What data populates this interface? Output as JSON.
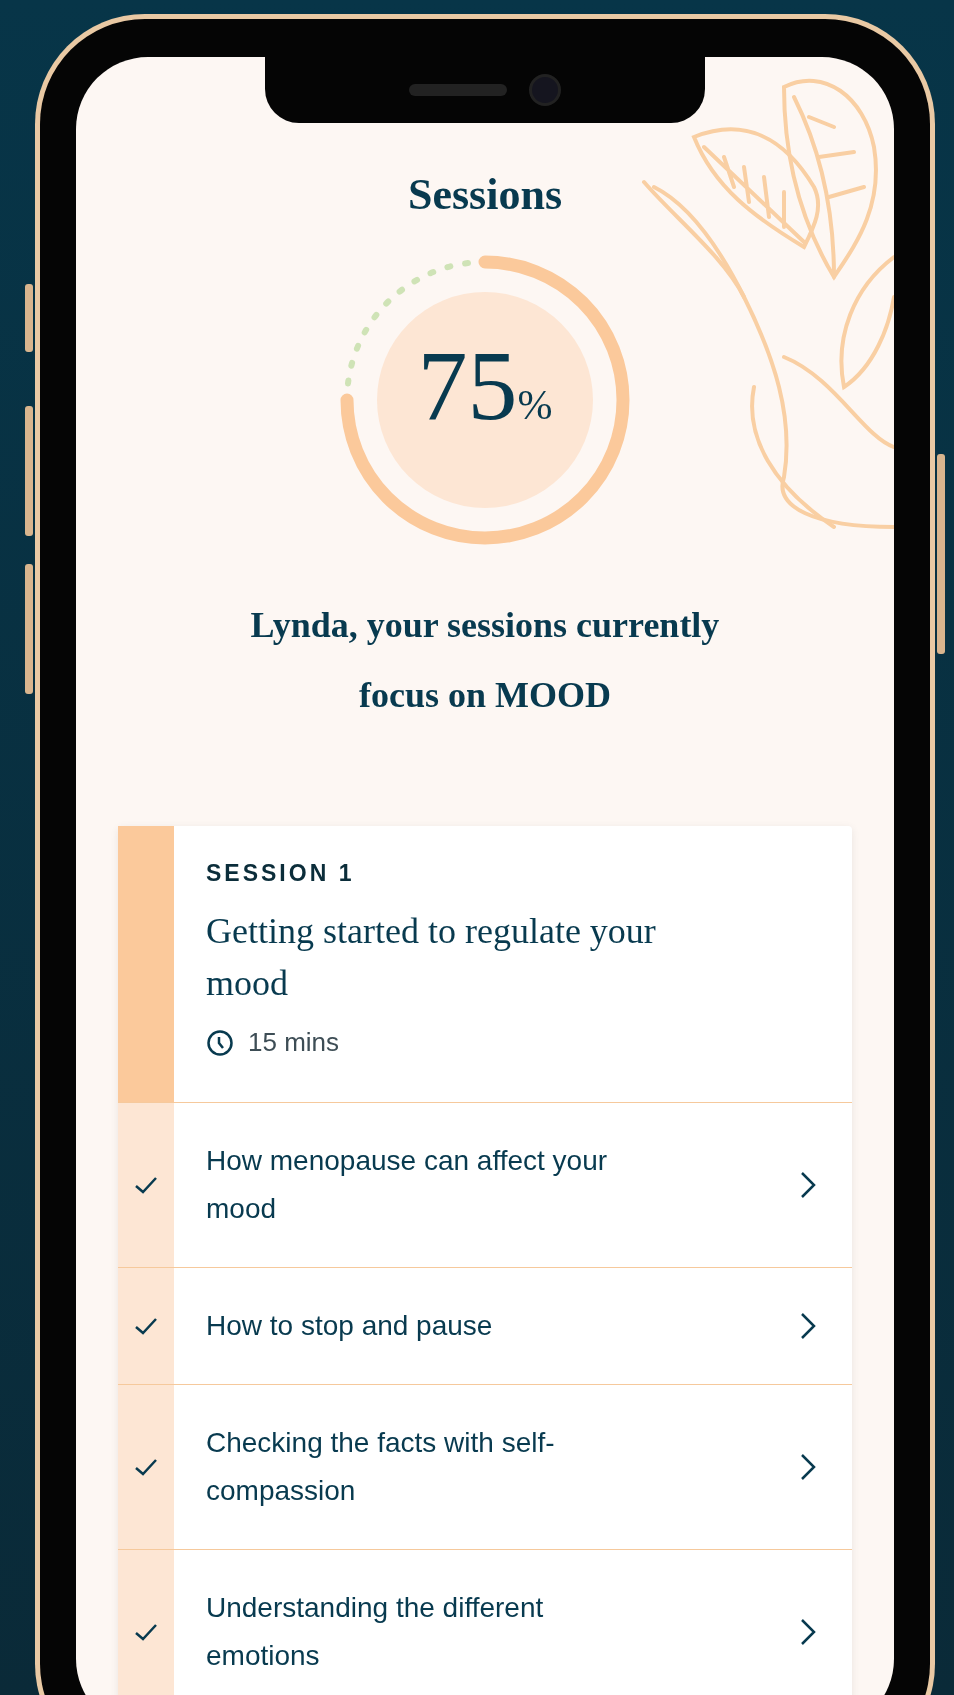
{
  "title": "Sessions",
  "progress": {
    "level": 0.75,
    "value": "75",
    "unit": "%"
  },
  "headline": "Lynda, your sessions currently focus on **MOOD**",
  "session": {
    "label": "SESSION 1",
    "title": "Getting started to regulate your mood",
    "duration": "15 mins"
  },
  "lessons": [
    {
      "title": "How menopause can affect your mood",
      "checked": true
    },
    {
      "title": "How to stop and pause",
      "checked": true
    },
    {
      "title": "Checking the facts with self-compassion",
      "checked": true
    },
    {
      "title": "Understanding the different emotions",
      "checked": true
    }
  ]
}
